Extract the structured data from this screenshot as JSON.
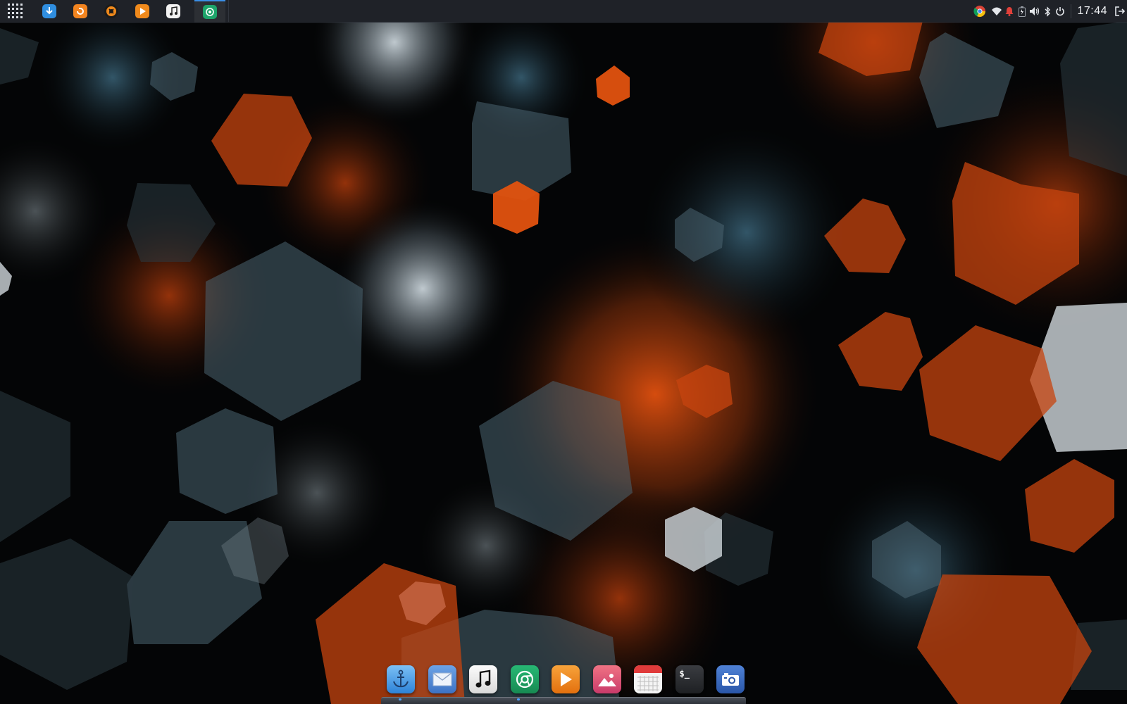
{
  "top_panel": {
    "launcher_icon": "app-grid-icon",
    "tasks": [
      {
        "icon": "download-manager-icon",
        "color": "#2f8ee0"
      },
      {
        "icon": "backup-app-icon",
        "color": "#f2841f"
      },
      {
        "icon": "media-player-icon",
        "color": "#1b1b1b"
      },
      {
        "icon": "video-player-icon",
        "color": "#f08a1c"
      },
      {
        "icon": "music-player-icon",
        "color": "#f2f2f2"
      },
      {
        "icon": "browser-icon",
        "color": "#1da46a"
      }
    ],
    "tray": {
      "icons": [
        "chrome-icon",
        "wifi-icon",
        "notification-bell-icon",
        "battery-icon",
        "volume-icon",
        "bluetooth-icon",
        "power-icon"
      ],
      "clock": "17:44",
      "logout_icon": "logout-icon"
    }
  },
  "dock": {
    "items": [
      {
        "name": "anchor-launcher",
        "icon": "anchor-icon",
        "color": "#3a9ae8"
      },
      {
        "name": "mail",
        "icon": "mail-icon",
        "color": "#4b87d4"
      },
      {
        "name": "music",
        "icon": "music-note-icon",
        "color": "#f3f3f3"
      },
      {
        "name": "browser",
        "icon": "chrome-icon",
        "color": "#1b9e62"
      },
      {
        "name": "video-player",
        "icon": "play-icon",
        "color": "#f08a1c"
      },
      {
        "name": "image-viewer",
        "icon": "picture-icon",
        "color": "#e85a6b"
      },
      {
        "name": "calendar",
        "icon": "calendar-icon",
        "color": "#f2f2f2"
      },
      {
        "name": "terminal",
        "icon": "terminal-icon",
        "color": "#2b2d31",
        "label": "$_"
      },
      {
        "name": "screenshot",
        "icon": "camera-icon",
        "color": "#2f62b8"
      }
    ]
  },
  "wallpaper": {
    "theme": "dark hexagons with orange and steel-blue bokeh"
  }
}
